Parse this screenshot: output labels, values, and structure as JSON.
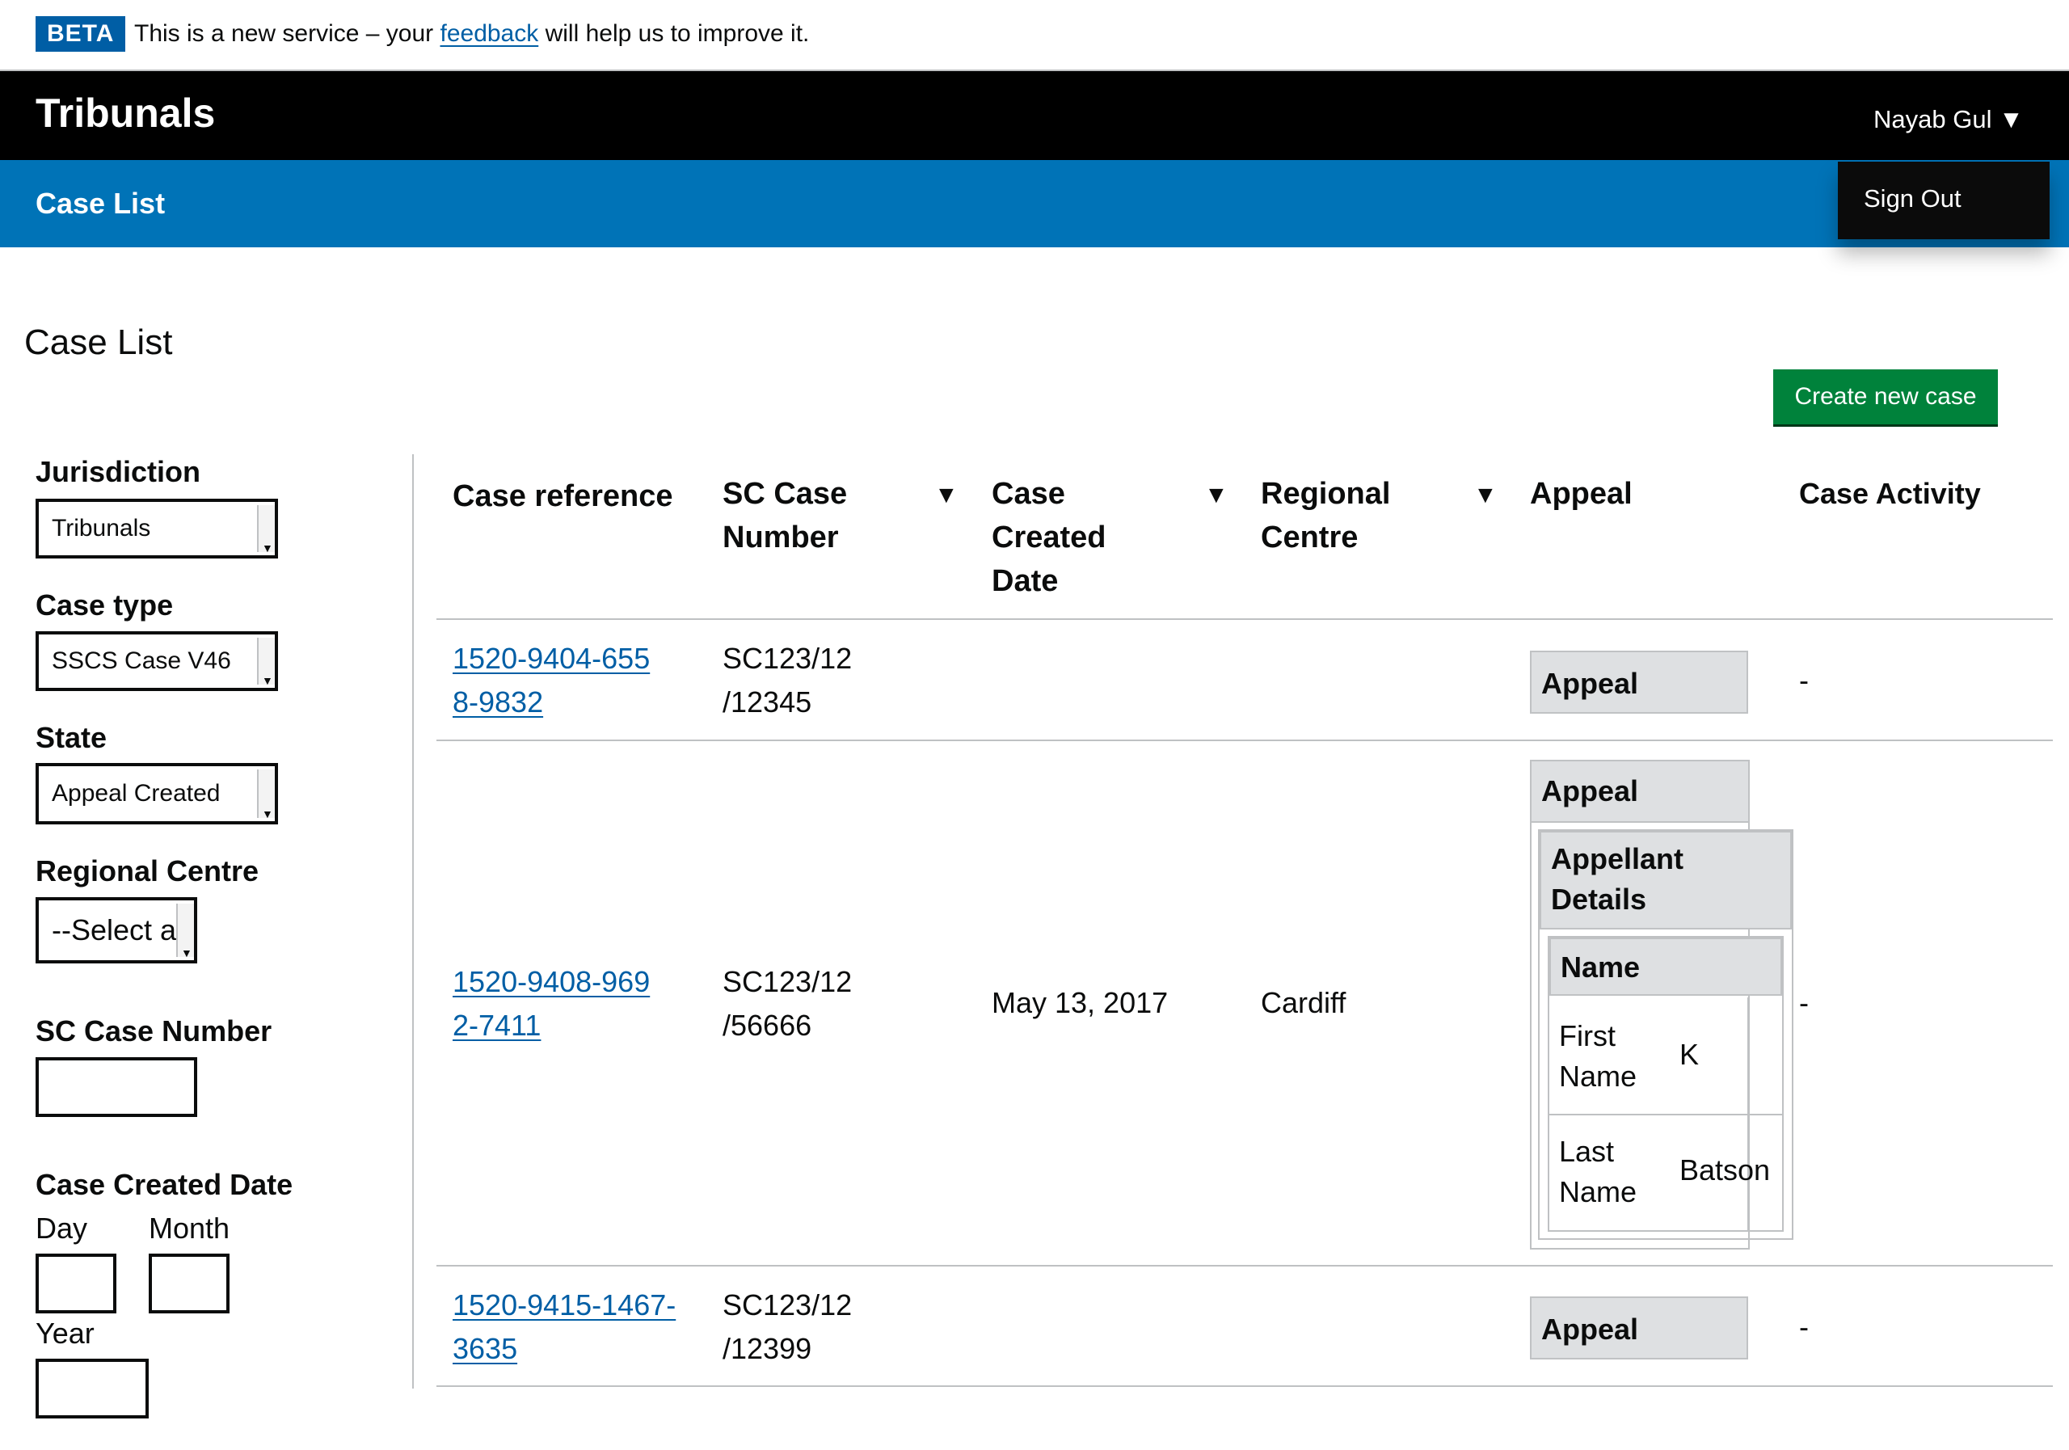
{
  "banner": {
    "tag": "BETA",
    "text_before": "This is a new service – your ",
    "link": "feedback",
    "text_after": " will help us to improve it."
  },
  "header": {
    "title": "Tribunals",
    "user_name": "Nayab Gul ▼",
    "menu": {
      "sign_out": "Sign Out"
    }
  },
  "nav": {
    "case_list": "Case List"
  },
  "page": {
    "title": "Case List",
    "create_button": "Create new case"
  },
  "filters": {
    "jurisdiction": {
      "label": "Jurisdiction",
      "value": "Tribunals"
    },
    "case_type": {
      "label": "Case type",
      "value": "SSCS Case V46"
    },
    "state": {
      "label": "State",
      "value": "Appeal Created"
    },
    "regional_centre": {
      "label": "Regional Centre",
      "value": "--Select a value--"
    },
    "sc_case_number": {
      "label": "SC Case Number",
      "value": ""
    },
    "case_created_date": {
      "label": "Case Created Date",
      "day": "Day",
      "month": "Month",
      "year": "Year"
    }
  },
  "table": {
    "headers": {
      "case_reference": "Case reference",
      "sc_case_number": [
        "SC Case",
        "Number"
      ],
      "case_created_date": [
        "Case",
        "Created",
        "Date"
      ],
      "regional_centre": [
        "Regional",
        "Centre"
      ],
      "appeal": "Appeal",
      "case_activity": "Case Activity",
      "sort_glyph": "▼"
    },
    "rows": [
      {
        "case_reference": [
          "1520-9404-655",
          "8-9832"
        ],
        "sc_case_number": [
          "SC123/12",
          "/12345"
        ],
        "case_created_date": "",
        "regional_centre": "",
        "appeal": "Appeal",
        "case_activity": "-"
      },
      {
        "case_reference": [
          "1520-9408-969",
          "2-7411"
        ],
        "sc_case_number": [
          "SC123/12",
          "/56666"
        ],
        "case_created_date": "May 13, 2017",
        "regional_centre": "Cardiff",
        "appeal": "Appeal",
        "appellant_details": [
          "Appellant",
          "Details"
        ],
        "name_heading": "Name",
        "first_name_label": [
          "First",
          "Name"
        ],
        "first_name_value": "K",
        "last_name_label": [
          "Last",
          "Name"
        ],
        "last_name_value": "Batson",
        "case_activity": "-"
      },
      {
        "case_reference": [
          "1520-9415-1467-",
          "3635"
        ],
        "sc_case_number": [
          "SC123/12",
          "/12399"
        ],
        "case_created_date": "",
        "regional_centre": "",
        "appeal": "Appeal",
        "case_activity": "-"
      }
    ]
  }
}
